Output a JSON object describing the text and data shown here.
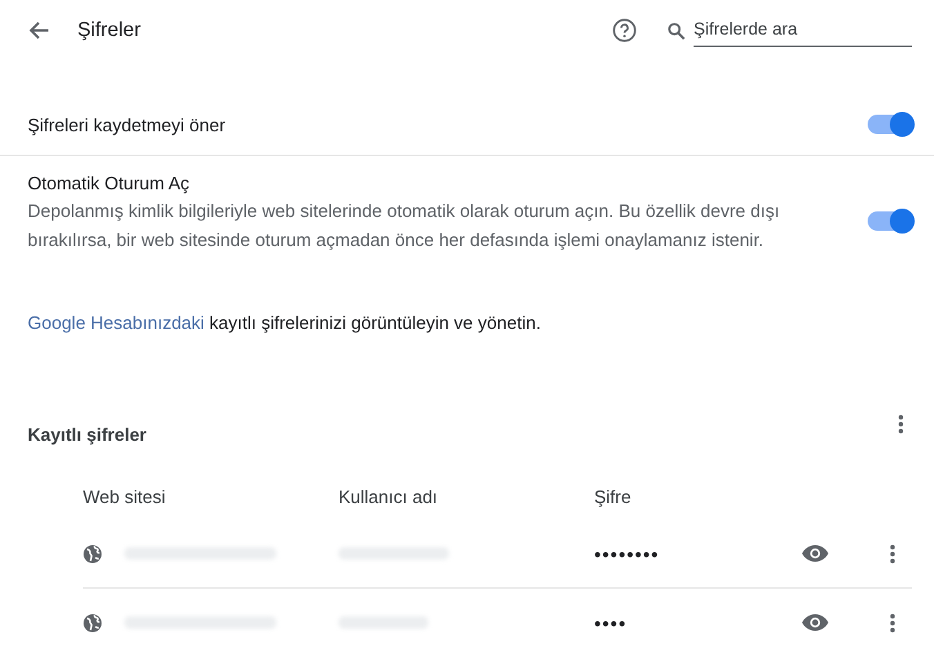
{
  "header": {
    "title": "Şifreler",
    "search": {
      "placeholder": "Şifrelerde ara"
    }
  },
  "settings": [
    {
      "kind": "simple",
      "label": "Şifreleri kaydetmeyi öner",
      "on": true
    },
    {
      "kind": "described",
      "label": "Otomatik Oturum Aç",
      "description": "Depolanmış kimlik bilgileriyle web sitelerinde otomatik olarak oturum açın. Bu özellik devre dışı bırakılırsa, bir web sitesinde oturum açmadan önce her defasında işlemi onaylamanız istenir.",
      "on": true
    }
  ],
  "account_note": {
    "link": "Google Hesabınızdaki",
    "text": " kayıtlı şifrelerinizi görüntüleyin ve yönetin."
  },
  "saved": {
    "title": "Kayıtlı şifreler",
    "columns": [
      "Web sitesi",
      "Kullanıcı adı",
      "Şifre"
    ],
    "rows": [
      {
        "password": "••••••••"
      },
      {
        "password": "••••"
      }
    ]
  }
}
